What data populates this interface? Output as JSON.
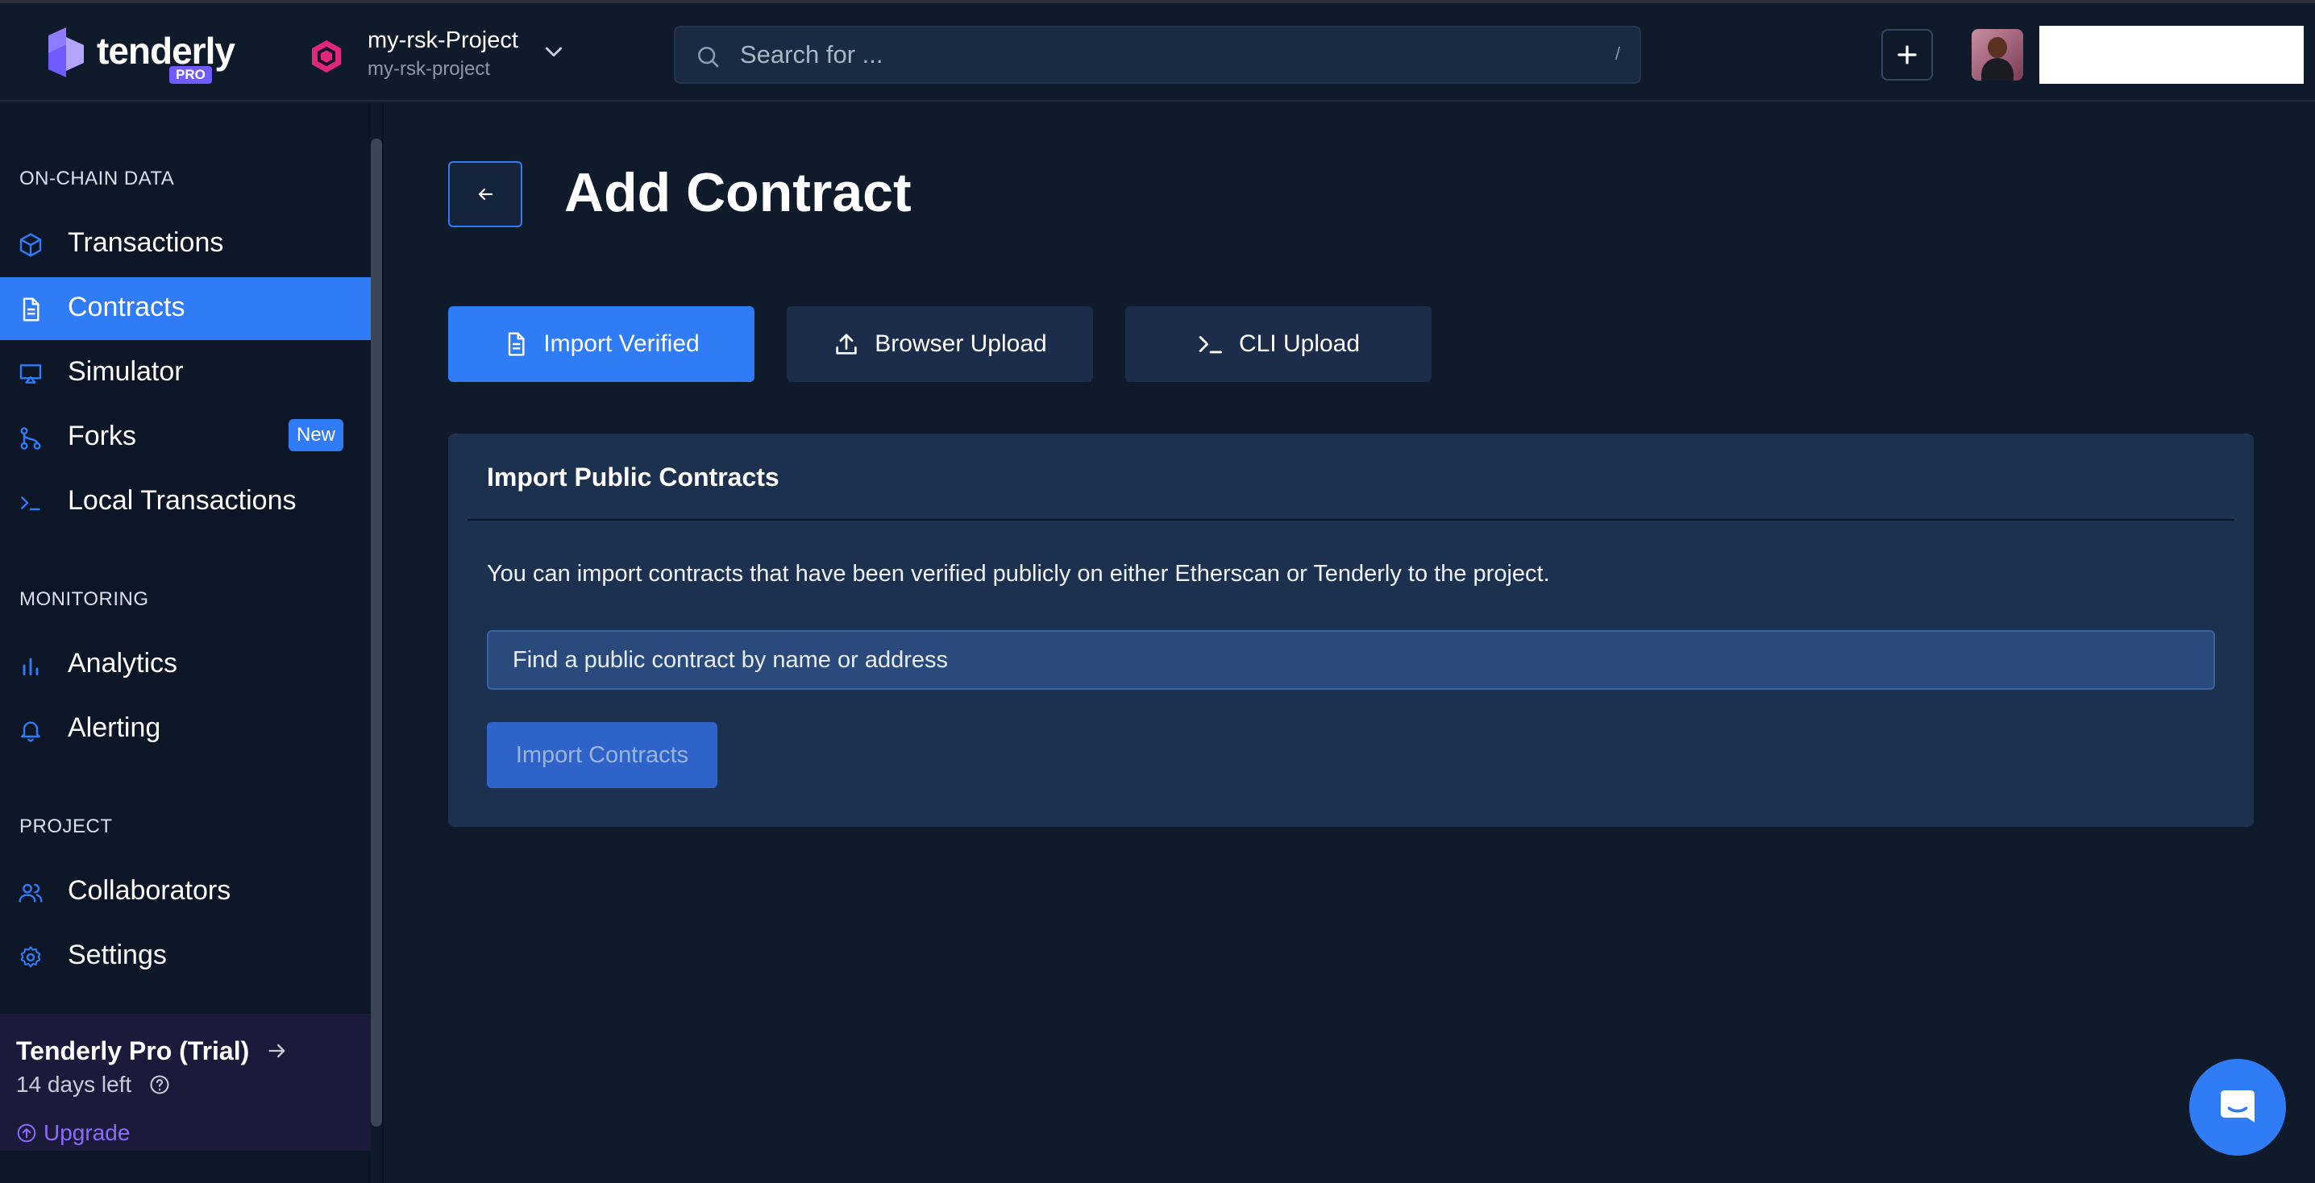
{
  "header": {
    "logo_text": "tenderly",
    "logo_badge": "PRO",
    "project_name": "my-rsk-Project",
    "project_slug": "my-rsk-project",
    "search_placeholder": "Search for ...",
    "search_shortcut": "/"
  },
  "sidebar": {
    "sections": [
      {
        "label": "ON-CHAIN DATA",
        "items": [
          {
            "label": "Transactions",
            "icon": "cube-icon"
          },
          {
            "label": "Contracts",
            "icon": "document-icon",
            "active": true
          },
          {
            "label": "Simulator",
            "icon": "monitor-icon"
          },
          {
            "label": "Forks",
            "icon": "fork-icon",
            "badge": "New"
          },
          {
            "label": "Local Transactions",
            "icon": "terminal-icon"
          }
        ]
      },
      {
        "label": "MONITORING",
        "items": [
          {
            "label": "Analytics",
            "icon": "bar-chart-icon"
          },
          {
            "label": "Alerting",
            "icon": "bell-icon"
          }
        ]
      },
      {
        "label": "PROJECT",
        "items": [
          {
            "label": "Collaborators",
            "icon": "users-icon"
          },
          {
            "label": "Settings",
            "icon": "gear-icon"
          }
        ]
      }
    ],
    "trial": {
      "title": "Tenderly Pro (Trial)",
      "days_left": "14 days left",
      "upgrade": "Upgrade"
    }
  },
  "main": {
    "title": "Add Contract",
    "tabs": [
      {
        "label": "Import Verified",
        "icon": "document-icon",
        "active": true
      },
      {
        "label": "Browser Upload",
        "icon": "upload-icon"
      },
      {
        "label": "CLI Upload",
        "icon": "terminal-icon"
      }
    ],
    "panel": {
      "title": "Import Public Contracts",
      "description": "You can import contracts that have been verified publicly on either Etherscan or Tenderly to the project.",
      "input_placeholder": "Find a public contract by name or address",
      "button_label": "Import Contracts"
    }
  },
  "colors": {
    "background": "#0f1a2b",
    "sidebar": "#0c1626",
    "accent": "#2f7cf6",
    "panel": "#1c3150",
    "upgrade": "#8d6bff"
  }
}
